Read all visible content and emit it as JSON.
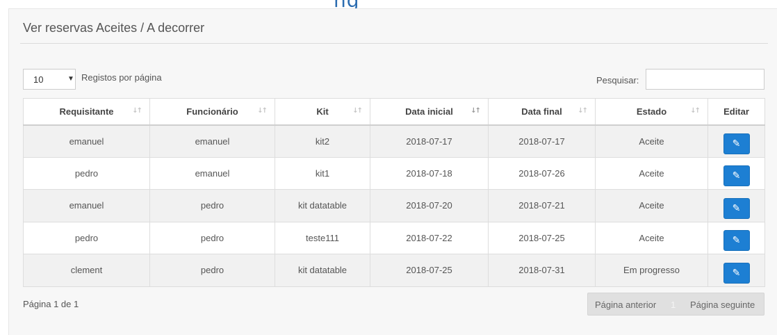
{
  "page": {
    "title": "Ver reservas Aceites / A decorrer"
  },
  "length": {
    "selected": "10",
    "label": "Registos por página"
  },
  "search": {
    "label": "Pesquisar:",
    "value": ""
  },
  "table": {
    "columns": [
      "Requisitante",
      "Funcionário",
      "Kit",
      "Data inicial",
      "Data final",
      "Estado",
      "Editar"
    ],
    "rows": [
      {
        "requisitante": "emanuel",
        "funcionario": "emanuel",
        "kit": "kit2",
        "data_inicial": "2018-07-17",
        "data_final": "2018-07-17",
        "estado": "Aceite"
      },
      {
        "requisitante": "pedro",
        "funcionario": "emanuel",
        "kit": "kit1",
        "data_inicial": "2018-07-18",
        "data_final": "2018-07-26",
        "estado": "Aceite"
      },
      {
        "requisitante": "emanuel",
        "funcionario": "pedro",
        "kit": "kit datatable",
        "data_inicial": "2018-07-20",
        "data_final": "2018-07-21",
        "estado": "Aceite"
      },
      {
        "requisitante": "pedro",
        "funcionario": "pedro",
        "kit": "teste111",
        "data_inicial": "2018-07-22",
        "data_final": "2018-07-25",
        "estado": "Aceite"
      },
      {
        "requisitante": "clement",
        "funcionario": "pedro",
        "kit": "kit datatable",
        "data_inicial": "2018-07-25",
        "data_final": "2018-07-31",
        "estado": "Em progresso"
      }
    ]
  },
  "footer": {
    "info": "Página 1 de 1"
  },
  "pagination": {
    "prev": "Página anterior",
    "current": "1",
    "next": "Página seguinte"
  },
  "icons": {
    "sort": "sort-arrows-icon",
    "edit": "pencil-icon",
    "caret": "caret-down-icon"
  },
  "colors": {
    "primary": "#1d7fd3",
    "brand": "#2b6cb0"
  }
}
